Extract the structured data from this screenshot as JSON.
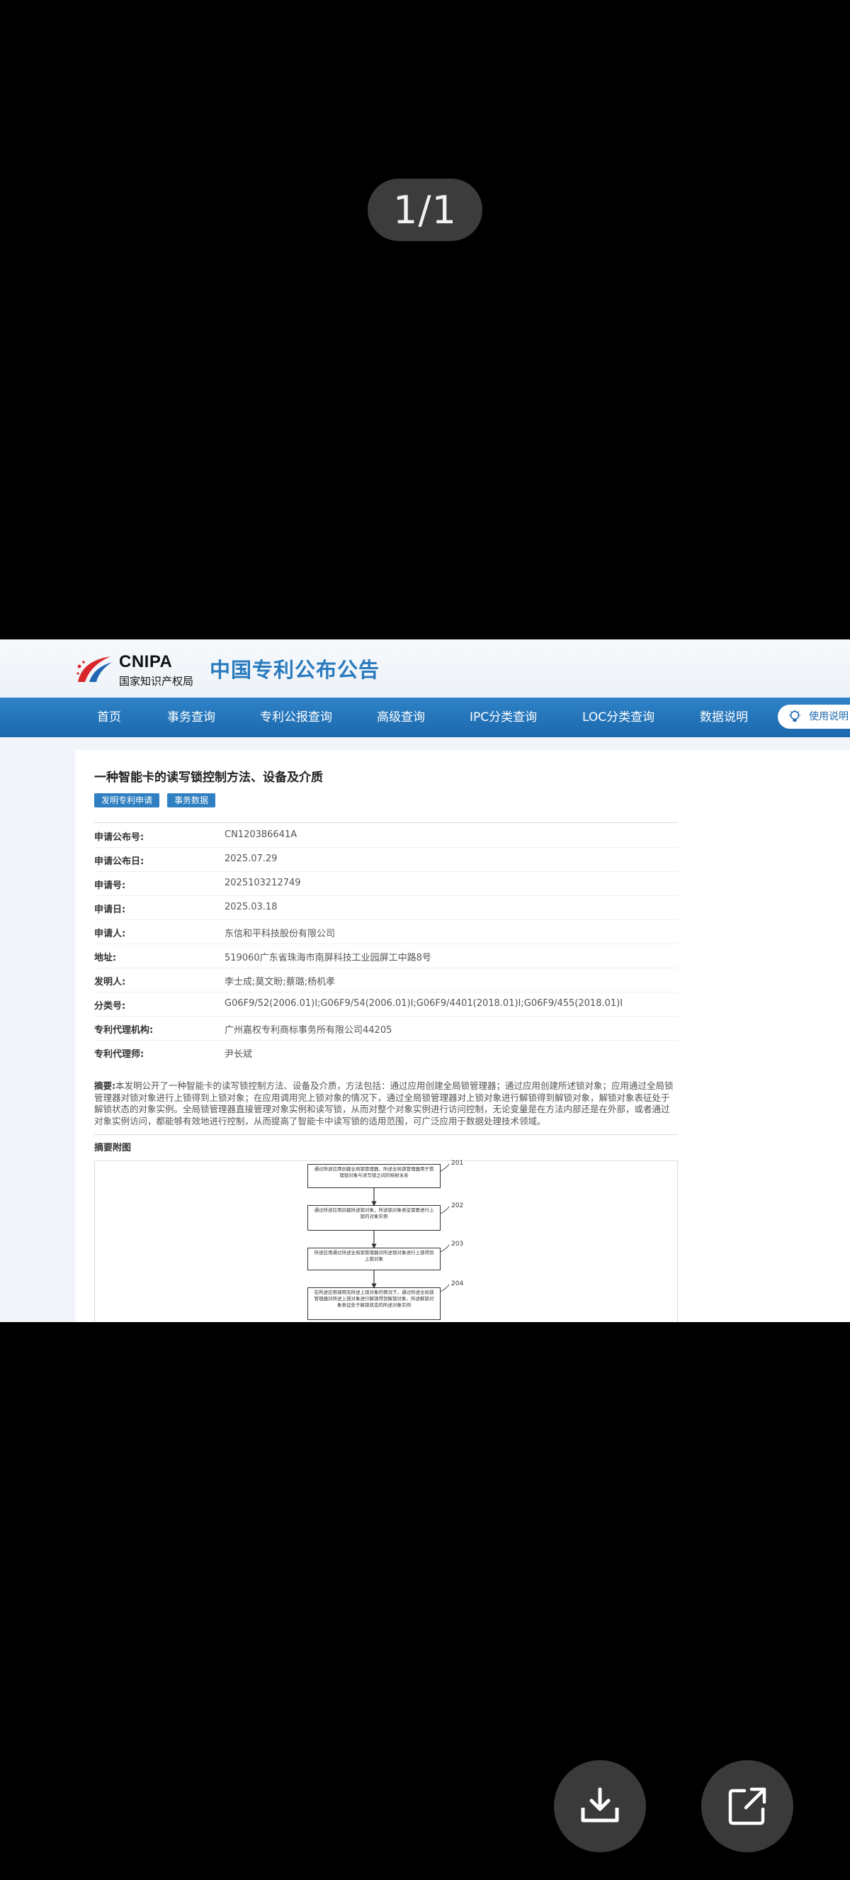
{
  "viewer": {
    "page_counter": "1/1"
  },
  "header": {
    "logo_text": "CNIPA",
    "logo_subtext": "国家知识产权局",
    "site_title": "中国专利公布公告"
  },
  "nav": {
    "items": [
      "首页",
      "事务查询",
      "专利公报查询",
      "高级查询",
      "IPC分类查询",
      "LOC分类查询",
      "数据说明"
    ],
    "help_label": "使用说明"
  },
  "patent": {
    "title": "一种智能卡的读写锁控制方法、设备及介质",
    "tags": [
      "发明专利申请",
      "事务数据"
    ],
    "fields": [
      {
        "label": "申请公布号:",
        "value": "CN120386641A"
      },
      {
        "label": "申请公布日:",
        "value": "2025.07.29"
      },
      {
        "label": "申请号:",
        "value": "2025103212749"
      },
      {
        "label": "申请日:",
        "value": "2025.03.18"
      },
      {
        "label": "申请人:",
        "value": "东信和平科技股份有限公司"
      },
      {
        "label": "地址:",
        "value": "519060广东省珠海市南屏科技工业园屏工中路8号"
      },
      {
        "label": "发明人:",
        "value": "李士成;莫文盼;蔡璐;杨机孝"
      },
      {
        "label": "分类号:",
        "value": "G06F9/52(2006.01)I;G06F9/54(2006.01)I;G06F9/4401(2018.01)I;G06F9/455(2018.01)I"
      },
      {
        "label": "专利代理机构:",
        "value": "广州嘉权专利商标事务所有限公司44205"
      },
      {
        "label": "专利代理师:",
        "value": "尹长斌"
      }
    ],
    "abstract_label": "摘要:",
    "abstract_text": "本发明公开了一种智能卡的读写锁控制方法、设备及介质，方法包括：通过应用创建全局锁管理器；通过应用创建所述锁对象；应用通过全局锁管理器对锁对象进行上锁得到上锁对象；在应用调用完上锁对象的情况下，通过全局锁管理器对上锁对象进行解锁得到解锁对象，解锁对象表征处于解锁状态的对象实例。全局锁管理器直接管理对象实例和读写锁，从而对整个对象实例进行访问控制，无论变量是在方法内部还是在外部，或者通过对象实例访问，都能够有效地进行控制，从而提高了智能卡中读写锁的适用范围，可广泛应用于数据处理技术领域。",
    "figure_label": "摘要附图",
    "flow_steps": [
      {
        "num": "201",
        "text": "通过所述应用创建全局锁管理器，所述全局锁管理器用于管理锁对象与读写锁之间的映射关系"
      },
      {
        "num": "202",
        "text": "通过所述应用创建所述锁对象，所述锁对象表征需要进行上锁的对象实例"
      },
      {
        "num": "203",
        "text": "所述应用通过所述全局锁管理器对所述锁对象进行上锁得到上锁对象"
      },
      {
        "num": "204",
        "text": "在所述应用调用完所述上锁对象的情况下，通过所述全局锁管理器对所述上锁对象进行解锁得到解锁对象，所述解锁对象表征处于解锁状态的所述对象实例"
      }
    ]
  },
  "actions": {
    "download_icon": "download-icon",
    "share_icon": "share-icon"
  }
}
